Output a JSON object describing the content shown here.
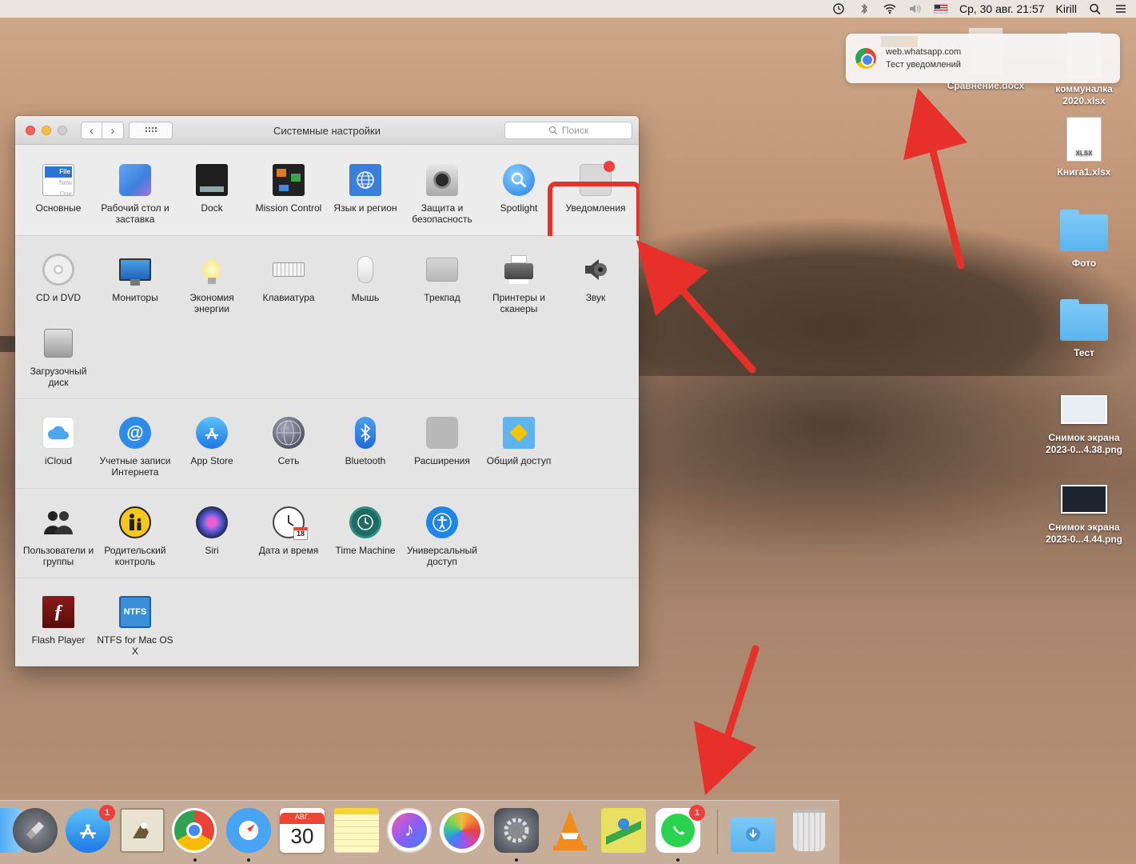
{
  "menubar": {
    "datetime": "Ср, 30 авг.  21:57",
    "user": "Kirill"
  },
  "notification": {
    "source": "web.whatsapp.com",
    "message": "Тест уведомлений"
  },
  "desktop": {
    "items": [
      {
        "label": "Сравнение.docx"
      },
      {
        "label": "коммуналка 2020.xlsx"
      },
      {
        "label": "Книга1.xlsx"
      },
      {
        "label": "Фото"
      },
      {
        "label": "Тест"
      },
      {
        "label": "Снимок экрана 2023-0...4.38.png"
      },
      {
        "label": "Снимок экрана 2023-0...4.44.png"
      }
    ],
    "xlsx_tag": "XLSX"
  },
  "window": {
    "title": "Системные настройки",
    "search_placeholder": "Поиск",
    "rows": [
      [
        {
          "label": "Основные",
          "icon": "general-icon"
        },
        {
          "label": "Рабочий стол и заставка",
          "icon": "desktop-icon"
        },
        {
          "label": "Dock",
          "icon": "dock-icon"
        },
        {
          "label": "Mission Control",
          "icon": "mission-control-icon"
        },
        {
          "label": "Язык и регион",
          "icon": "globe-icon"
        },
        {
          "label": "Защита и безопасность",
          "icon": "security-icon"
        },
        {
          "label": "Spotlight",
          "icon": "magnifier-icon"
        },
        {
          "label": "Уведомления",
          "icon": "notifications-icon"
        }
      ],
      [
        {
          "label": "CD и DVD",
          "icon": "cd-icon"
        },
        {
          "label": "Мониторы",
          "icon": "monitor-icon"
        },
        {
          "label": "Экономия энергии",
          "icon": "bulb-icon"
        },
        {
          "label": "Клавиатура",
          "icon": "keyboard-icon"
        },
        {
          "label": "Мышь",
          "icon": "mouse-icon"
        },
        {
          "label": "Трекпад",
          "icon": "trackpad-icon"
        },
        {
          "label": "Принтеры и сканеры",
          "icon": "printer-icon"
        },
        {
          "label": "Звук",
          "icon": "speaker-icon"
        },
        {
          "label": "Загрузочный диск",
          "icon": "disk-icon"
        }
      ],
      [
        {
          "label": "iCloud",
          "icon": "cloud-icon"
        },
        {
          "label": "Учетные записи Интернета",
          "icon": "at-icon"
        },
        {
          "label": "App Store",
          "icon": "appstore-icon"
        },
        {
          "label": "Сеть",
          "icon": "network-icon"
        },
        {
          "label": "Bluetooth",
          "icon": "bluetooth-icon"
        },
        {
          "label": "Расширения",
          "icon": "puzzle-icon"
        },
        {
          "label": "Общий доступ",
          "icon": "sharing-icon"
        }
      ],
      [
        {
          "label": "Пользователи и группы",
          "icon": "users-icon"
        },
        {
          "label": "Родительский контроль",
          "icon": "parental-icon"
        },
        {
          "label": "Siri",
          "icon": "siri-icon"
        },
        {
          "label": "Дата и время",
          "icon": "clock-icon"
        },
        {
          "label": "Time Machine",
          "icon": "timemachine-icon"
        },
        {
          "label": "Универсальный доступ",
          "icon": "accessibility-icon"
        }
      ],
      [
        {
          "label": "Flash Player",
          "icon": "flash-icon"
        },
        {
          "label": "NTFS for Mac OS X",
          "icon": "ntfs-icon"
        }
      ]
    ],
    "general_icon_text": [
      "File",
      "New",
      "One"
    ],
    "ntfs_text": "NTFS",
    "calendar_day": "18"
  },
  "dock": {
    "appstore_badge": "1",
    "whatsapp_badge": "1",
    "calendar_month": "АВГ.",
    "calendar_day": "30"
  },
  "colors": {
    "accent_red": "#e8302a",
    "badge_red": "#f0403c",
    "folder_blue": "#5ab4ef"
  }
}
